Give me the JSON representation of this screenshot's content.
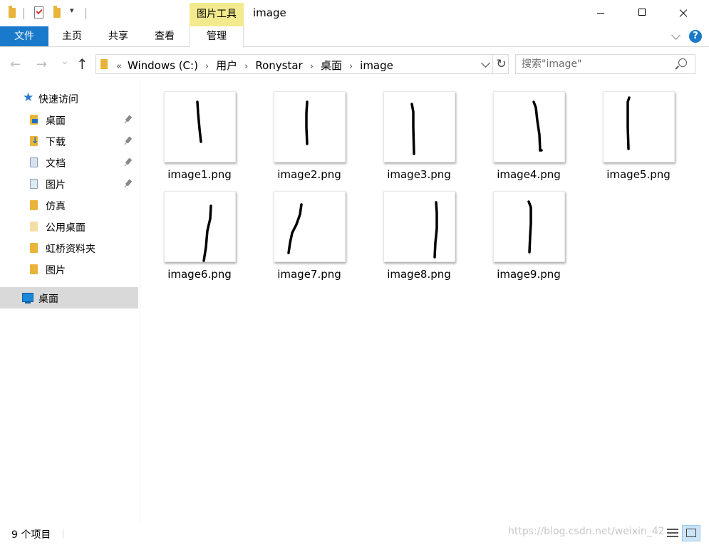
{
  "quick_access_toolbar": {
    "icons": [
      "folder-icon",
      "properties-icon",
      "new-folder-icon",
      "customize-dropdown-icon"
    ],
    "dropdown_glyph": "▾"
  },
  "context_tab_group": "图片工具",
  "window": {
    "title": "image",
    "controls": [
      "minimize-icon",
      "maximize-icon",
      "close-icon"
    ]
  },
  "ribbon": {
    "file_label": "文件",
    "tabs": [
      "主页",
      "共享",
      "查看"
    ],
    "manage_label": "管理",
    "help_glyph": "?"
  },
  "colors": {
    "accent": "#1979ca",
    "context_tab": "#f2ea8c",
    "folder": "#e8b43a",
    "selection": "#d9d9d9"
  },
  "nav_buttons": {
    "back": "←",
    "forward": "→",
    "recent": "⌄",
    "up": "↑"
  },
  "address": {
    "overflow": "«",
    "separator": "›",
    "crumbs": [
      "Windows (C:)",
      "用户",
      "Ronystar",
      "桌面",
      "image"
    ],
    "refresh_glyph": "↻"
  },
  "search": {
    "placeholder": "搜索\"image\""
  },
  "sidebar": {
    "quick_access_label": "快速访问",
    "items": [
      {
        "label": "桌面",
        "pinned": true,
        "icon": "desktop-folder-icon"
      },
      {
        "label": "下载",
        "pinned": true,
        "icon": "downloads-folder-icon"
      },
      {
        "label": "文档",
        "pinned": true,
        "icon": "documents-folder-icon"
      },
      {
        "label": "图片",
        "pinned": true,
        "icon": "pictures-folder-icon"
      },
      {
        "label": "仿真",
        "pinned": false,
        "icon": "folder-icon"
      },
      {
        "label": "公用桌面",
        "pinned": false,
        "icon": "folder-icon"
      },
      {
        "label": "虹桥资料夹",
        "pinned": false,
        "icon": "folder-icon"
      },
      {
        "label": "图片",
        "pinned": false,
        "icon": "folder-icon"
      }
    ],
    "desktop_label": "桌面"
  },
  "files": [
    {
      "name": "image1.png",
      "thumbnail": "vertical-stroke-slight-lean-icon"
    },
    {
      "name": "image2.png",
      "thumbnail": "vertical-stroke-icon"
    },
    {
      "name": "image3.png",
      "thumbnail": "vertical-stroke-icon"
    },
    {
      "name": "image4.png",
      "thumbnail": "curved-stroke-icon"
    },
    {
      "name": "image5.png",
      "thumbnail": "vertical-stroke-icon"
    },
    {
      "name": "image6.png",
      "thumbnail": "slanted-stroke-icon"
    },
    {
      "name": "image7.png",
      "thumbnail": "slanted-curved-stroke-icon"
    },
    {
      "name": "image8.png",
      "thumbnail": "vertical-stroke-icon"
    },
    {
      "name": "image9.png",
      "thumbnail": "vertical-stroke-icon"
    }
  ],
  "status": {
    "item_count": "9 个项目",
    "watermark": "https://blog.csdn.net/weixin_42"
  }
}
